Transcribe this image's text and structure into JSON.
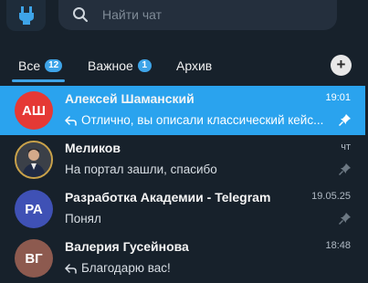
{
  "search": {
    "placeholder": "Найти чат"
  },
  "tabs": [
    {
      "label": "Все",
      "badge": "12"
    },
    {
      "label": "Важное",
      "badge": "1"
    },
    {
      "label": "Архив"
    }
  ],
  "add_button": "+",
  "chats": [
    {
      "name": "Алексей Шаманский",
      "initials": "АШ",
      "avatar_color": "#e53935",
      "preview": "Отлично, вы описали классический кейс...",
      "time": "19:01",
      "pinned": true,
      "active": true
    },
    {
      "name": "Меликов",
      "initials": "",
      "preview": "На портал зашли, спасибо",
      "time": "чт",
      "pinned": true
    },
    {
      "name": "Разработка Академии - Telegram",
      "initials": "РА",
      "avatar_color": "#3f51b5",
      "preview": "Понял",
      "time": "19.05.25",
      "pinned": true
    },
    {
      "name": "Валерия Гусейнова",
      "initials": "ВГ",
      "avatar_color": "#8d5a4f",
      "preview": "Благодарю вас!",
      "time": "18:48",
      "pinned": false
    }
  ],
  "colors": {
    "background": "#17212b",
    "accent": "#2aa3ee",
    "badge": "#3ea4e8"
  }
}
